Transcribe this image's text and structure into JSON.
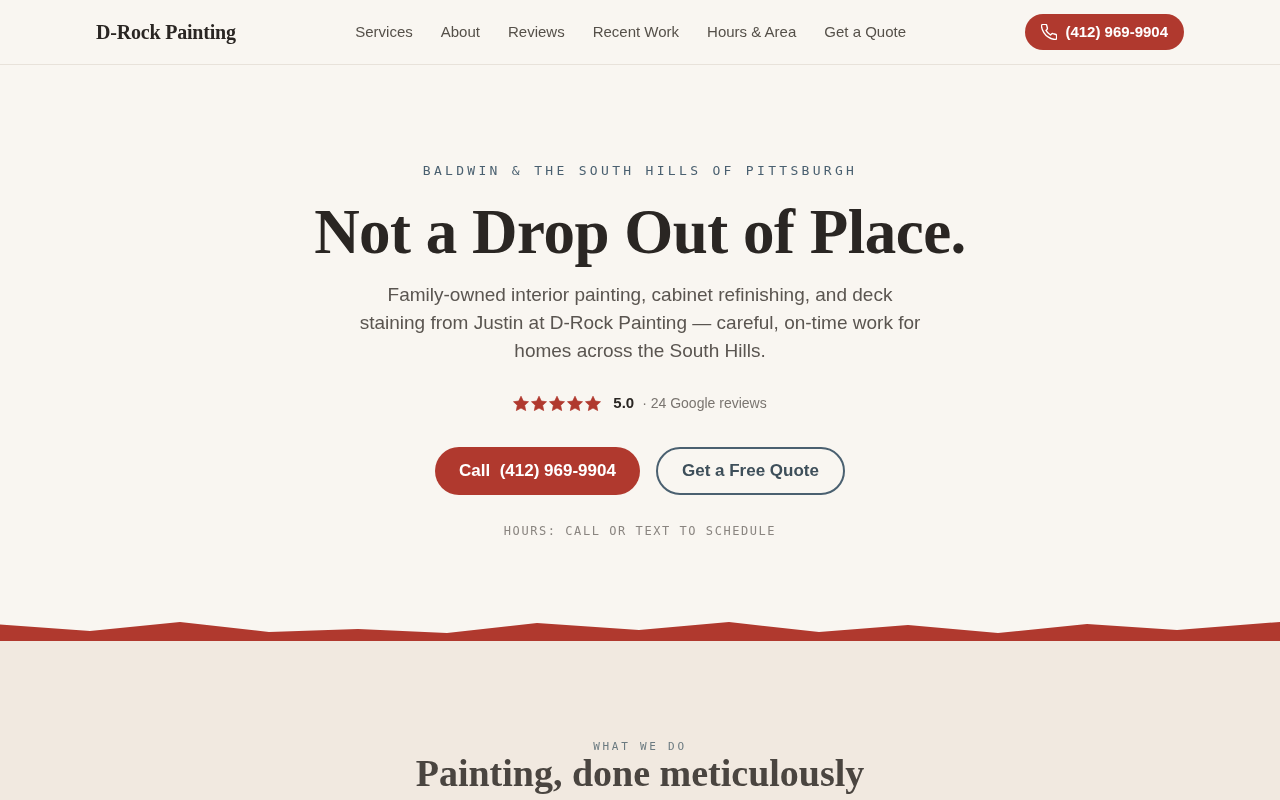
{
  "header": {
    "logo": "D-Rock Painting",
    "nav": [
      {
        "label": "Services"
      },
      {
        "label": "About"
      },
      {
        "label": "Reviews"
      },
      {
        "label": "Recent Work"
      },
      {
        "label": "Hours & Area"
      },
      {
        "label": "Get a Quote"
      }
    ],
    "phone_button": {
      "label": "(412) 969-9904"
    }
  },
  "hero": {
    "eyebrow": "BALDWIN & THE SOUTH HILLS OF PITTSBURGH",
    "title": "Not a Drop Out of Place.",
    "description": "Family-owned interior painting, cabinet refinishing, and deck staining from Justin at D-Rock Painting — careful, on-time work for homes across the South Hills.",
    "rating": {
      "stars": 5,
      "score": "5.0",
      "reviews": "· 24 Google reviews"
    },
    "buttons": [
      {
        "kind": "primary",
        "label": "Call  (412) 969-9904"
      },
      {
        "kind": "outline",
        "label": "Get a Free Quote"
      }
    ],
    "note": "HOURS: CALL OR TEXT TO SCHEDULE"
  },
  "services": {
    "eyebrow": "WHAT WE DO",
    "title": "Painting, done meticulously"
  }
}
